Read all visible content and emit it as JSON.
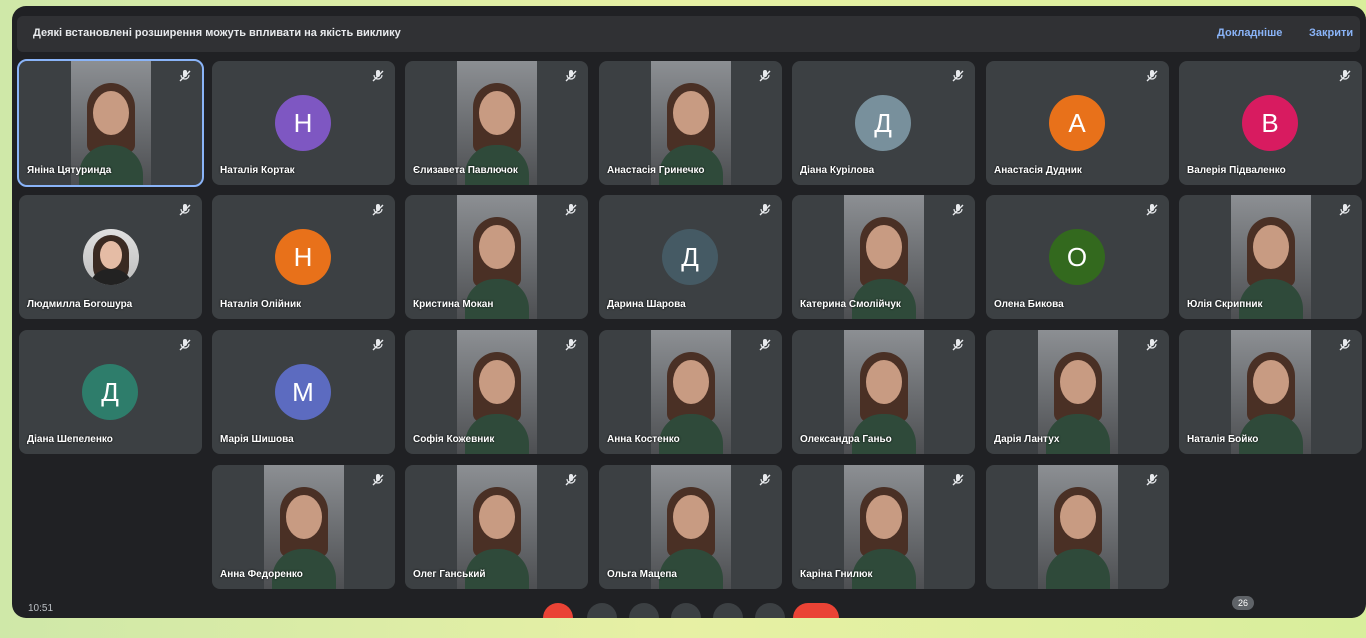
{
  "banner": {
    "text": "Деякі встановлені розширення можуть впливати на якість виклику",
    "learn_more": "Докладніше",
    "close": "Закрити"
  },
  "participants": [
    {
      "name": "Яніна Цятуринда",
      "type": "video"
    },
    {
      "name": "Наталія Кортак",
      "type": "avatar",
      "initial": "Н",
      "color": "#7e57c2"
    },
    {
      "name": "Єлизавета Павлючок",
      "type": "video"
    },
    {
      "name": "Анастасія Гринечко",
      "type": "video"
    },
    {
      "name": "Діана Курілова",
      "type": "avatar",
      "initial": "Д",
      "color": "#78909c"
    },
    {
      "name": "Анастасія Дудник",
      "type": "avatar",
      "initial": "А",
      "color": "#e8711a"
    },
    {
      "name": "Валерія Підваленко",
      "type": "avatar",
      "initial": "В",
      "color": "#d81b60"
    },
    {
      "name": "Людмилла Богошура",
      "type": "photo"
    },
    {
      "name": "Наталія Олійник",
      "type": "avatar",
      "initial": "Н",
      "color": "#e8711a"
    },
    {
      "name": "Кристина Мокан",
      "type": "video"
    },
    {
      "name": "Дарина Шарова",
      "type": "avatar",
      "initial": "Д",
      "color": "#455a64"
    },
    {
      "name": "Катерина Смолійчук",
      "type": "video"
    },
    {
      "name": "Олена Бикова",
      "type": "avatar",
      "initial": "О",
      "color": "#33691e"
    },
    {
      "name": "Юлія Скрипник",
      "type": "video"
    },
    {
      "name": "Діана Шепеленко",
      "type": "avatar",
      "initial": "Д",
      "color": "#2e7d6b"
    },
    {
      "name": "Марія Шишова",
      "type": "avatar",
      "initial": "М",
      "color": "#5c6bc0"
    },
    {
      "name": "Софія Кожевник",
      "type": "video"
    },
    {
      "name": "Анна Костенко",
      "type": "video"
    },
    {
      "name": "Олександра Ганьо",
      "type": "video"
    },
    {
      "name": "Дарія Лантух",
      "type": "video"
    },
    {
      "name": "Наталія Бойко",
      "type": "video"
    },
    {
      "name": "Анна Федоренко",
      "type": "video"
    },
    {
      "name": "Олег Ганський",
      "type": "video"
    },
    {
      "name": "Ольга Мацепа",
      "type": "video"
    },
    {
      "name": "Каріна Гнилюк",
      "type": "video"
    },
    {
      "name": "",
      "type": "video"
    }
  ],
  "bottom_bar": {
    "clock": "10:51",
    "participants_count": "26"
  }
}
